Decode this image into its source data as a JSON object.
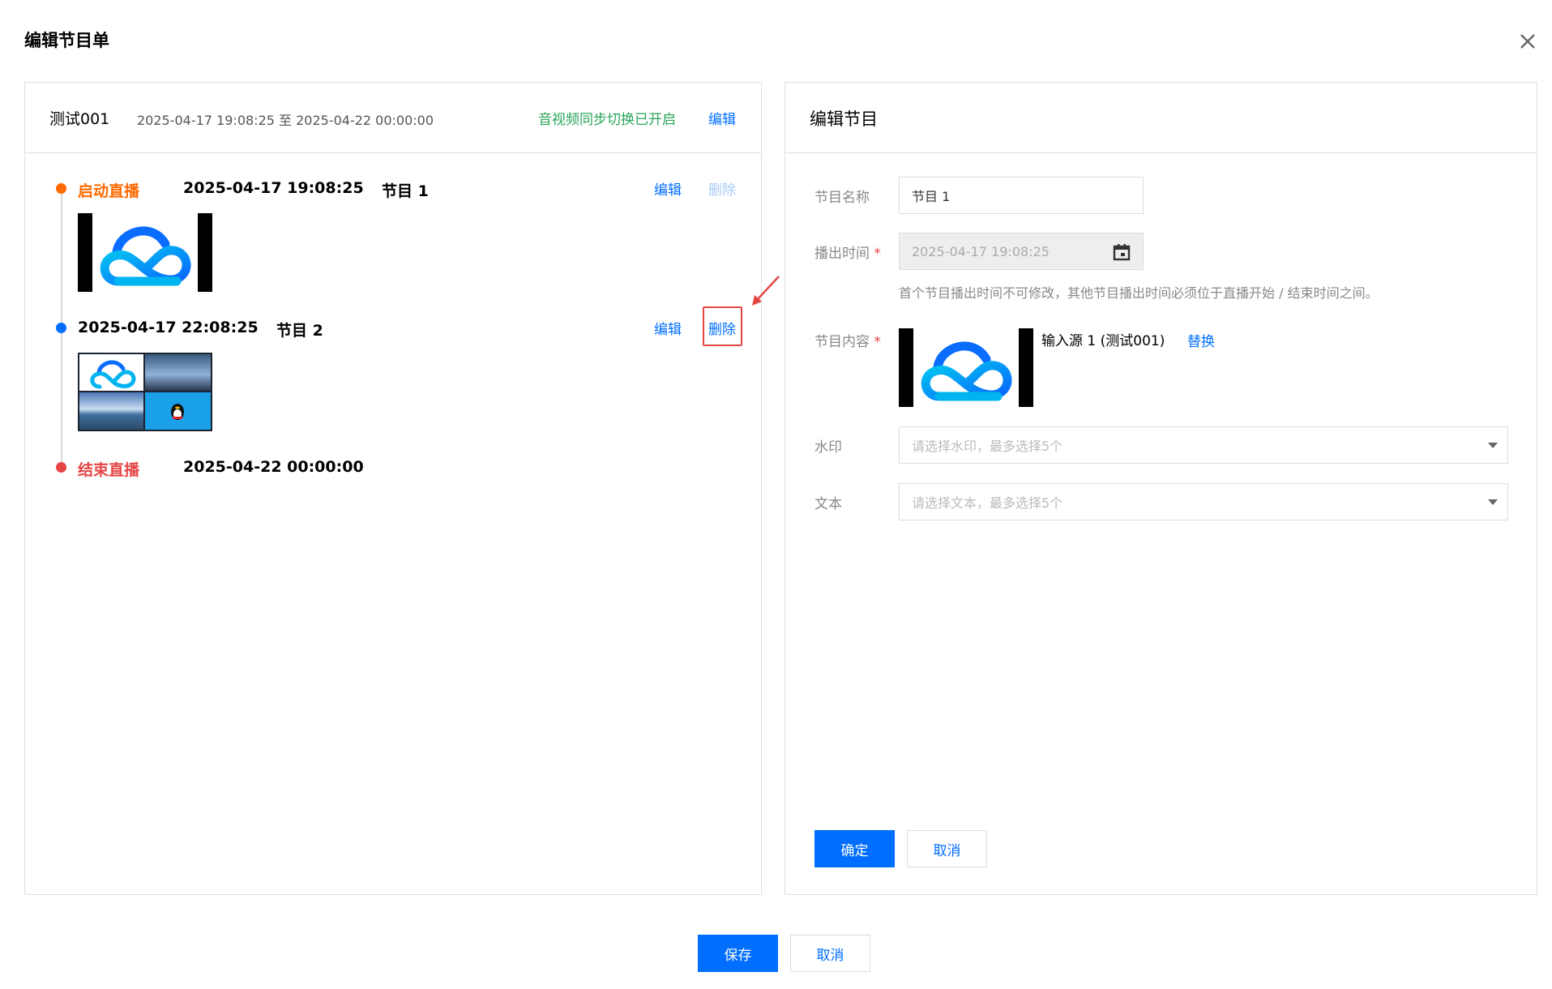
{
  "dialog": {
    "title": "编辑节目单",
    "close_icon": "close-icon"
  },
  "schedule": {
    "name": "测试001",
    "range": "2025-04-17 19:08:25 至 2025-04-22 00:00:00",
    "sync_status": "音视频同步切换已开启",
    "edit_label": "编辑"
  },
  "timeline": [
    {
      "label": "启动直播",
      "time": "2025-04-17 19:08:25",
      "program": "节目 1",
      "edit": "编辑",
      "delete": "删除",
      "delete_enabled": false
    },
    {
      "label": "",
      "time": "2025-04-17 22:08:25",
      "program": "节目 2",
      "edit": "编辑",
      "delete": "删除",
      "delete_enabled": true
    },
    {
      "label": "结束直播",
      "time": "2025-04-22 00:00:00",
      "program": ""
    }
  ],
  "edit_panel": {
    "title": "编辑节目",
    "fields": {
      "name_label": "节目名称",
      "name_value": "节目 1",
      "time_label": "播出时间",
      "time_value": "2025-04-17 19:08:25",
      "time_hint": "首个节目播出时间不可修改，其他节目播出时间必须位于直播开始 / 结束时间之间。",
      "content_label": "节目内容",
      "content_source": "输入源 1 (测试001)",
      "replace_label": "替换",
      "watermark_label": "水印",
      "watermark_placeholder": "请选择水印，最多选择5个",
      "text_label": "文本",
      "text_placeholder": "请选择文本，最多选择5个",
      "required_mark": "*"
    },
    "confirm_label": "确定",
    "cancel_label": "取消"
  },
  "footer": {
    "save_label": "保存",
    "cancel_label": "取消"
  },
  "colors": {
    "primary": "#006eff",
    "start": "#ff6a00",
    "end": "#e54545",
    "sync": "#29a559"
  }
}
